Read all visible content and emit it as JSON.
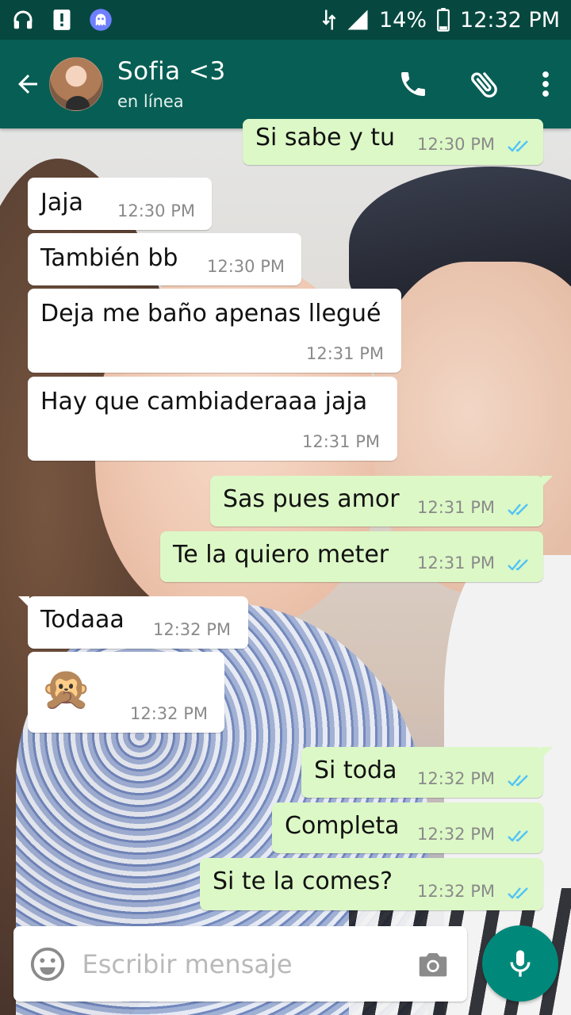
{
  "status_bar": {
    "battery": "14%",
    "time": "12:32 PM",
    "icons": [
      "headphones-icon",
      "alert-icon",
      "ghost-app-icon",
      "data-arrows-icon",
      "signal-icon",
      "battery-icon"
    ]
  },
  "header": {
    "contact_name": "Sofia <3",
    "contact_status": "en línea",
    "actions": [
      "call-icon",
      "attach-icon",
      "more-icon"
    ]
  },
  "messages": [
    {
      "dir": "out",
      "text": "Si sabe y tu",
      "time": "12:30 PM",
      "read": true
    },
    {
      "dir": "in",
      "text": "Jaja",
      "time": "12:30 PM"
    },
    {
      "dir": "in",
      "text": "También bb",
      "time": "12:30 PM"
    },
    {
      "dir": "in",
      "text": "Deja me baño apenas llegué",
      "time": "12:31 PM"
    },
    {
      "dir": "in",
      "text": "Hay que cambiaderaaa jaja",
      "time": "12:31 PM"
    },
    {
      "dir": "out",
      "text": "Sas pues amor",
      "time": "12:31 PM",
      "read": true
    },
    {
      "dir": "out",
      "text": "Te la quiero meter",
      "time": "12:31 PM",
      "read": true
    },
    {
      "dir": "in",
      "text": "Todaaa",
      "time": "12:32 PM"
    },
    {
      "dir": "in",
      "text": "🙊",
      "time": "12:32 PM",
      "emoji_name": "speak-no-evil-monkey"
    },
    {
      "dir": "out",
      "text": "Si toda",
      "time": "12:32 PM",
      "read": true
    },
    {
      "dir": "out",
      "text": "Completa",
      "time": "12:32 PM",
      "read": true
    },
    {
      "dir": "out",
      "text": "Si te la comes?",
      "time": "12:32 PM",
      "read": true
    }
  ],
  "composer": {
    "placeholder": "Escribir mensaje",
    "value": ""
  },
  "colors": {
    "status_bar": "#06483f",
    "app_bar": "#075e54",
    "bubble_out": "#dcf8c6",
    "bubble_in": "#ffffff",
    "read_ticks": "#4fc3f7",
    "fab": "#00897b"
  }
}
